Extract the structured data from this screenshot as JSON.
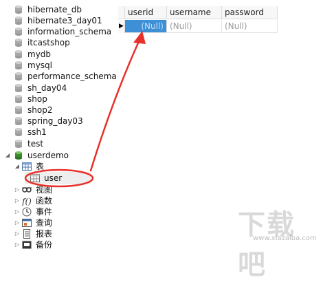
{
  "databases": [
    {
      "label": "hibernate_db"
    },
    {
      "label": "hibernate3_day01"
    },
    {
      "label": "information_schema"
    },
    {
      "label": "itcastshop"
    },
    {
      "label": "mydb"
    },
    {
      "label": "mysql"
    },
    {
      "label": "performance_schema"
    },
    {
      "label": "sh_day04"
    },
    {
      "label": "shop"
    },
    {
      "label": "shop2"
    },
    {
      "label": "spring_day03"
    },
    {
      "label": "ssh1"
    },
    {
      "label": "test"
    },
    {
      "label": "userdemo"
    }
  ],
  "userdemo_children": {
    "tables": {
      "label": "表"
    },
    "table_user": {
      "label": "user"
    },
    "views": {
      "label": "视图"
    },
    "functions": {
      "label": "函数"
    },
    "events": {
      "label": "事件"
    },
    "queries": {
      "label": "查询"
    },
    "reports": {
      "label": "报表"
    },
    "backups": {
      "label": "备份"
    }
  },
  "grid": {
    "columns": [
      "userid",
      "username",
      "password"
    ],
    "rows": [
      [
        "(Null)",
        "(Null)",
        "(Null)"
      ]
    ]
  },
  "watermark": {
    "title": "下载吧",
    "url": "www.xiazaiba.com"
  },
  "colors": {
    "accent_annotation": "#e8302a",
    "active_cell": "#3d8fd6",
    "db_icon": "#a8a8a8",
    "db_icon_active": "#3b8b2e"
  }
}
